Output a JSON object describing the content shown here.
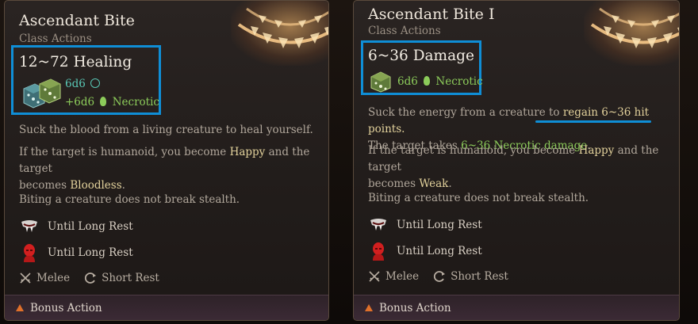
{
  "cards": [
    {
      "title": "Ascendant Bite",
      "subtitle": "Class Actions",
      "effect": "12~72 Healing",
      "roll_primary": "6d6",
      "roll_secondary": "+6d6",
      "roll_secondary_type": "Necrotic",
      "desc1": "Suck the blood from a living creature to heal yourself.",
      "desc2_a": "If the target is humanoid, you become ",
      "desc2_happy": "Happy",
      "desc2_b": " and the target",
      "desc2_c": "becomes ",
      "desc2_state": "Bloodless",
      "desc2_end": ".",
      "desc3": "Biting a creature does not break stealth.",
      "status1": "Until Long Rest",
      "status2": "Until Long Rest",
      "tag_range": "Melee",
      "tag_recharge": "Short Rest",
      "action_type": "Bonus Action"
    },
    {
      "title": "Ascendant Bite I",
      "subtitle": "Class Actions",
      "effect": "6~36 Damage",
      "roll_primary": "6d6",
      "roll_primary_type": "Necrotic",
      "desc1_a": "Suck the energy from a creature to ",
      "desc1_link": "regain 6~36 hit points.",
      "desc1b_a": "The target takes ",
      "desc1b_dmg": "6~36 Necrotic damage",
      "desc1b_end": ".",
      "desc2_a": "If the target is humanoid, you become ",
      "desc2_happy": "Happy",
      "desc2_b": " and the target",
      "desc2_c": "becomes ",
      "desc2_state": "Weak",
      "desc2_end": ".",
      "desc3": "Biting a creature does not break stealth.",
      "status1": "Until Long Rest",
      "status2": "Until Long Rest",
      "tag_range": "Melee",
      "tag_recharge": "Short Rest",
      "action_type": "Bonus Action"
    }
  ],
  "colors": {
    "highlight": "#0f8ed6",
    "teal": "#59c7b5",
    "green": "#8ccb5a",
    "yellow": "#e3d29c",
    "action_triangle": "#e0702a"
  },
  "icons": [
    "glowing-mouth-icon",
    "dice-icon",
    "radiant-icon",
    "necrotic-icon",
    "vampire-fang-icon",
    "red-head-icon",
    "crossed-swords-icon",
    "recharge-icon",
    "bonus-action-icon"
  ]
}
